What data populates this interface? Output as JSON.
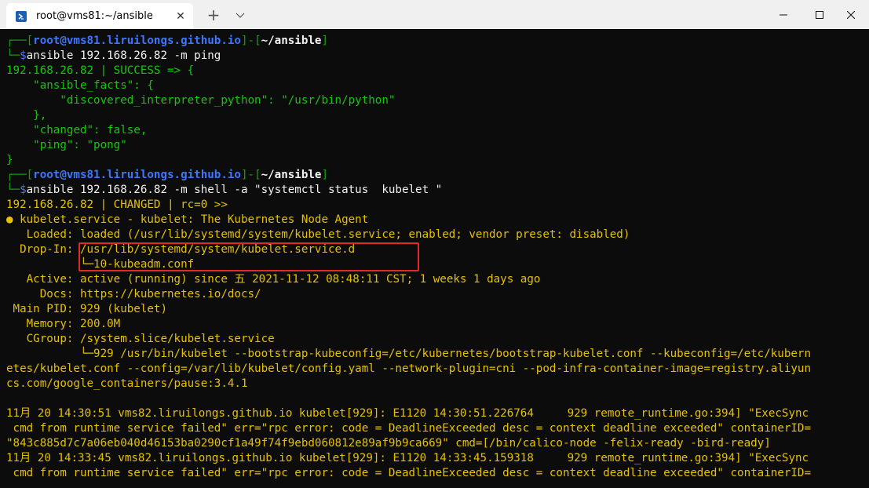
{
  "window": {
    "tab_title": "root@vms81:~/ansible",
    "tab_close": "✕",
    "new_tab": "+",
    "dropdown": "⌄"
  },
  "terminal": {
    "lines": [
      [
        {
          "t": "┌──[",
          "c": "c-frame"
        },
        {
          "t": "root@vms81.liruilongs.github.io",
          "c": "c-user"
        },
        {
          "t": "]-[",
          "c": "c-frame"
        },
        {
          "t": "~/ansible",
          "c": "c-path"
        },
        {
          "t": "]",
          "c": "c-frame"
        }
      ],
      [
        {
          "t": "└─",
          "c": "c-frame"
        },
        {
          "t": "$",
          "c": "c-prompt"
        },
        {
          "t": "ansible 192.168.26.82 -m ping",
          "c": "c-cmd"
        }
      ],
      [
        {
          "t": "192.168.26.82 | SUCCESS => {",
          "c": "c-green"
        }
      ],
      [
        {
          "t": "    \"ansible_facts\": {",
          "c": "c-green"
        }
      ],
      [
        {
          "t": "        \"discovered_interpreter_python\": \"/usr/bin/python\"",
          "c": "c-green"
        }
      ],
      [
        {
          "t": "    },",
          "c": "c-green"
        }
      ],
      [
        {
          "t": "    \"changed\": false,",
          "c": "c-green"
        }
      ],
      [
        {
          "t": "    \"ping\": \"pong\"",
          "c": "c-green"
        }
      ],
      [
        {
          "t": "}",
          "c": "c-green"
        }
      ],
      [
        {
          "t": "┌──[",
          "c": "c-frame"
        },
        {
          "t": "root@vms81.liruilongs.github.io",
          "c": "c-user"
        },
        {
          "t": "]-[",
          "c": "c-frame"
        },
        {
          "t": "~/ansible",
          "c": "c-path"
        },
        {
          "t": "]",
          "c": "c-frame"
        }
      ],
      [
        {
          "t": "└─",
          "c": "c-frame"
        },
        {
          "t": "$",
          "c": "c-prompt"
        },
        {
          "t": "ansible 192.168.26.82 -m shell -a \"systemctl status  kubelet \"",
          "c": "c-cmd"
        }
      ],
      [
        {
          "t": "192.168.26.82 | CHANGED | rc=0 >>",
          "c": "c-yellow"
        }
      ],
      [
        {
          "t": "● kubelet.service - kubelet: The Kubernetes Node Agent",
          "c": "c-yellow"
        }
      ],
      [
        {
          "t": "   Loaded: loaded (/usr/lib/systemd/system/kubelet.service; enabled; vendor preset: disabled)",
          "c": "c-yellow"
        }
      ],
      [
        {
          "t": "  Drop-In: /usr/lib/systemd/system/kubelet.service.d",
          "c": "c-yellow"
        }
      ],
      [
        {
          "t": "           └─10-kubeadm.conf",
          "c": "c-yellow"
        }
      ],
      [
        {
          "t": "   Active: active (running) since 五 2021-11-12 08:48:11 CST; 1 weeks 1 days ago",
          "c": "c-yellow"
        }
      ],
      [
        {
          "t": "     Docs: https://kubernetes.io/docs/",
          "c": "c-yellow"
        }
      ],
      [
        {
          "t": " Main PID: 929 (kubelet)",
          "c": "c-yellow"
        }
      ],
      [
        {
          "t": "   Memory: 200.0M",
          "c": "c-yellow"
        }
      ],
      [
        {
          "t": "   CGroup: /system.slice/kubelet.service",
          "c": "c-yellow"
        }
      ],
      [
        {
          "t": "           └─929 /usr/bin/kubelet --bootstrap-kubeconfig=/etc/kubernetes/bootstrap-kubelet.conf --kubeconfig=/etc/kubern",
          "c": "c-yellow"
        }
      ],
      [
        {
          "t": "etes/kubelet.conf --config=/var/lib/kubelet/config.yaml --network-plugin=cni --pod-infra-container-image=registry.aliyun",
          "c": "c-yellow"
        }
      ],
      [
        {
          "t": "cs.com/google_containers/pause:3.4.1",
          "c": "c-yellow"
        }
      ],
      [
        {
          "t": "",
          "c": "c-yellow"
        }
      ],
      [
        {
          "t": "11月 20 14:30:51 vms82.liruilongs.github.io kubelet[929]: E1120 14:30:51.226764     929 remote_runtime.go:394] \"ExecSync",
          "c": "c-yellow"
        }
      ],
      [
        {
          "t": " cmd from runtime service failed\" err=\"rpc error: code = DeadlineExceeded desc = context deadline exceeded\" containerID=",
          "c": "c-yellow"
        }
      ],
      [
        {
          "t": "\"843c885d7c7a06eb040d46153ba0290cf1a49f74f9ebd060812e89af9b9ca669\" cmd=[/bin/calico-node -felix-ready -bird-ready]",
          "c": "c-yellow"
        }
      ],
      [
        {
          "t": "11月 20 14:33:45 vms82.liruilongs.github.io kubelet[929]: E1120 14:33:45.159318     929 remote_runtime.go:394] \"ExecSync",
          "c": "c-yellow"
        }
      ],
      [
        {
          "t": " cmd from runtime service failed\" err=\"rpc error: code = DeadlineExceeded desc = context deadline exceeded\" containerID=",
          "c": "c-yellow"
        }
      ]
    ]
  }
}
